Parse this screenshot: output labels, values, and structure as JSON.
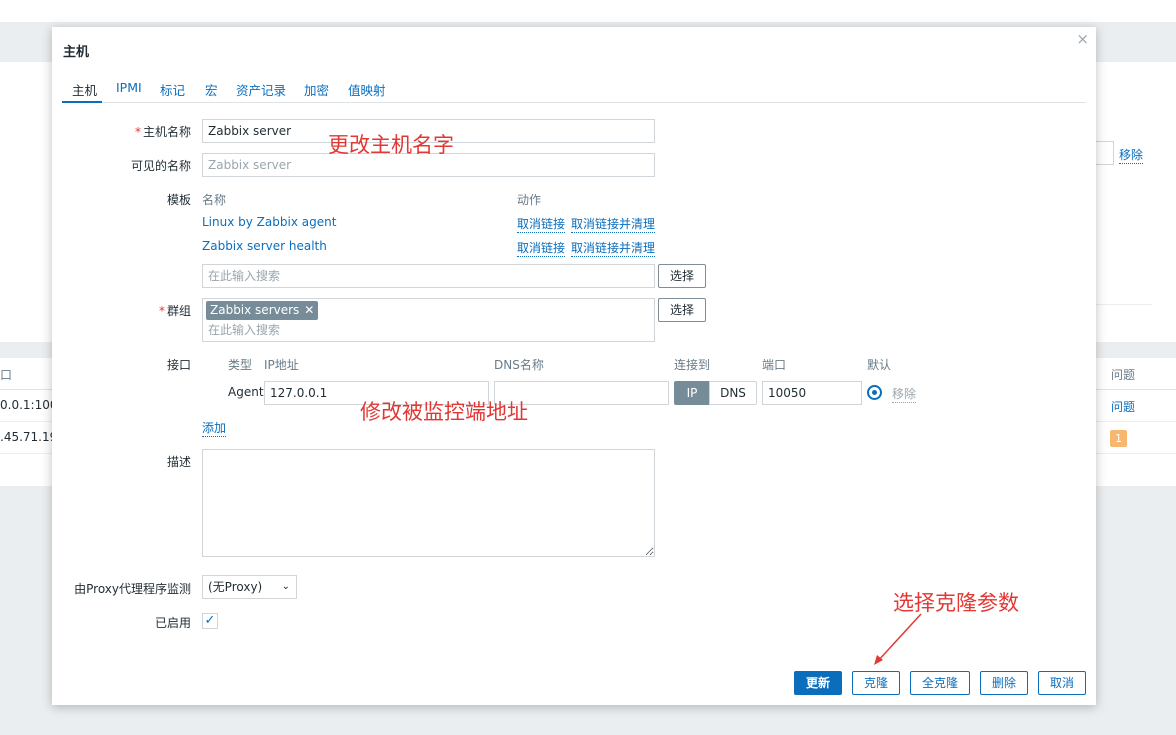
{
  "background": {
    "remove_link": "移除",
    "col_interface_fragment": "口",
    "col_problems": "问题",
    "row1_interface": "0.0.1:100",
    "row1_problems": "问题",
    "row2_interface": ".45.71.19",
    "row2_badge": "1"
  },
  "modal": {
    "title": "主机",
    "tabs": [
      "主机",
      "IPMI",
      "标记",
      "宏",
      "资产记录",
      "加密",
      "值映射"
    ],
    "host_name": {
      "label": "主机名称",
      "required_mark": "*",
      "value": "Zabbix server"
    },
    "visible_name": {
      "label": "可见的名称",
      "placeholder": "Zabbix server"
    },
    "templates": {
      "label": "模板",
      "col_name": "名称",
      "col_action": "动作",
      "items": [
        {
          "name": "Linux by Zabbix agent",
          "unlink": "取消链接",
          "unlink_clear": "取消链接并清理"
        },
        {
          "name": "Zabbix server health",
          "unlink": "取消链接",
          "unlink_clear": "取消链接并清理"
        }
      ],
      "search_placeholder": "在此输入搜索",
      "select_button": "选择"
    },
    "groups": {
      "label": "群组",
      "required_mark": "*",
      "chip": "Zabbix servers",
      "chip_remove": "✕",
      "search_placeholder": "在此输入搜索",
      "select_button": "选择"
    },
    "interfaces": {
      "label": "接口",
      "col_type": "类型",
      "col_ip": "IP地址",
      "col_dns": "DNS名称",
      "col_connect": "连接到",
      "col_port": "端口",
      "col_default": "默认",
      "agent": {
        "type": "Agent",
        "ip": "127.0.0.1",
        "dns": "",
        "connect_ip": "IP",
        "connect_dns": "DNS",
        "port": "10050",
        "remove": "移除"
      },
      "add_link": "添加"
    },
    "description": {
      "label": "描述",
      "value": ""
    },
    "proxy": {
      "label": "由Proxy代理程序监测",
      "selected": "(无Proxy)"
    },
    "enabled": {
      "label": "已启用",
      "checked": true,
      "check_glyph": "✓"
    },
    "buttons": {
      "update": "更新",
      "clone": "克隆",
      "full_clone": "全克隆",
      "delete": "删除",
      "cancel": "取消"
    },
    "close_glyph": "×"
  },
  "annotations": {
    "change_host_name": "更改主机名字",
    "change_agent_address": "修改被监控端地址",
    "select_clone": "选择克隆参数"
  },
  "colors": {
    "link": "#0a6ebd",
    "annotation": "#e33734",
    "chip_bg": "#768d99",
    "badge": "#f7b76e"
  }
}
